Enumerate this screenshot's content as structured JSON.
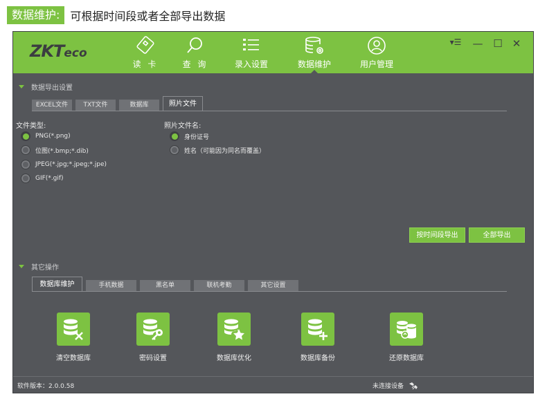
{
  "caption": {
    "tag": "数据维护:",
    "text": "可根据时间段或者全部导出数据"
  },
  "app": {
    "logo_main": "ZKT",
    "logo_sub": "eco"
  },
  "nav": [
    {
      "label": "读 卡",
      "icon": "card-reader-icon"
    },
    {
      "label": "查 询",
      "icon": "search-icon"
    },
    {
      "label": "录入设置",
      "icon": "checklist-icon"
    },
    {
      "label": "数据维护",
      "icon": "database-gear-icon"
    },
    {
      "label": "用户管理",
      "icon": "user-icon"
    }
  ],
  "window_controls": {
    "menu": "▾☰",
    "minimize": "—",
    "maximize": "☐",
    "close": "✕"
  },
  "export_section": {
    "title": "数据导出设置",
    "tabs": [
      "EXCEL文件",
      "TXT文件",
      "数据库",
      "照片文件"
    ],
    "active_tab": "照片文件",
    "file_type_label": "文件类型:",
    "file_types": [
      "PNG(*.png)",
      "位图(*.bmp;*.dib)",
      "JPEG(*.jpg;*.jpeg;*.jpe)",
      "GIF(*.gif)"
    ],
    "selected_file_type": "PNG(*.png)",
    "photo_name_label": "照片文件名:",
    "photo_names": [
      "身份证号",
      "姓名（可能因为同名而覆盖）"
    ],
    "selected_photo_name": "身份证号",
    "btn_by_period": "按时间段导出",
    "btn_export_all": "全部导出"
  },
  "other_section": {
    "title": "其它操作",
    "tabs": [
      "数据库维护",
      "手机数据",
      "黑名单",
      "联机考勤",
      "其它设置"
    ],
    "active_tab": "数据库维护",
    "tools": [
      {
        "label": "清空数据库",
        "icon": "database-clear-icon"
      },
      {
        "label": "密码设置",
        "icon": "database-key-icon"
      },
      {
        "label": "数据库优化",
        "icon": "database-star-icon"
      },
      {
        "label": "数据库备份",
        "icon": "database-backup-icon"
      },
      {
        "label": "还原数据库",
        "icon": "database-restore-icon"
      }
    ]
  },
  "status": {
    "version": "软件版本：2.0.0.58",
    "connection": "未连接设备"
  },
  "colors": {
    "accent": "#7dc242",
    "panel": "#54565a"
  }
}
